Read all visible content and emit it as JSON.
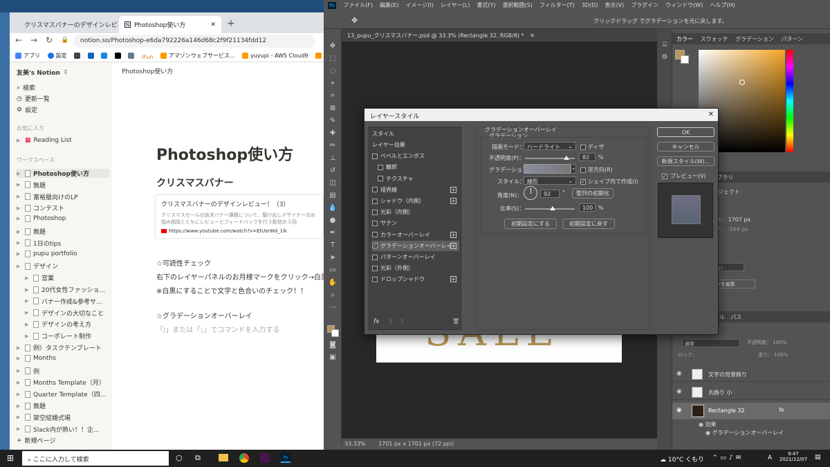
{
  "chrome": {
    "tabs": [
      {
        "title": "クリスマスバナーのデザインレビュー！"
      },
      {
        "title": "Photoshop使い方"
      }
    ],
    "url": "notion.so/Photoshop-e6da792226a146d68c2f9f21134fdd12",
    "bookmarks": [
      "アプリ",
      "設定",
      "",
      "",
      "",
      "",
      "",
      "iFun",
      "アマゾンウェブサービス...",
      "yuyupi - AWS Cloud9",
      "homew"
    ]
  },
  "notion": {
    "workspace": "友美's Notion",
    "top_items": [
      "検索",
      "更新一覧",
      "設定"
    ],
    "favorites_label": "お気に入り",
    "favorites": [
      "Reading List"
    ],
    "workspace_label": "ワークスペース",
    "pages": [
      "Photoshop使い方",
      "無題",
      "富裕層向けのLP",
      "コンテスト",
      "Photoshop",
      "無題",
      "1日のtips",
      "pupu portfolio",
      "デザイン",
      "営業",
      "20代女性ファッショ...",
      "バナー作成&参考サ...",
      "デザインの大切なこと",
      "デザインの考え方",
      "コーポレート制作",
      "例）タスクテンプレート",
      "Months",
      "例",
      "Months Template（月）",
      "Quarter Template（四...",
      "無題",
      "架空結婚式場",
      "Slack内が熱い！！企..."
    ],
    "new_page": "新規ページ",
    "breadcrumb": "Photoshop使い方",
    "title": "Photoshop使い方",
    "h2": "クリスマスバナー",
    "bookmark_title": "クリスマスバナーのデザインレビュー！（3）",
    "bookmark_desc": "クリスマスセールの訴求バナー課題について、駆け出しデザイナーのお悩み相談とともにレビューとフィードバックを行う配信の３回",
    "bookmark_url": "https://www.youtube.com/watch?v=EtUsrWd_1lk",
    "text1": "☆可読性チェック",
    "text2": "右下のレイヤーパネルのお月様マークをクリック→白黒",
    "text3": "※白黒にすることで文字と色合いのチェック！！",
    "text4": "☆グラデーションオーバーレイ",
    "placeholder": "「/」または「；」でコマンドを入力する"
  },
  "photoshop": {
    "menu": [
      "ファイル(F)",
      "編集(E)",
      "イメージ(I)",
      "レイヤー(L)",
      "書式(Y)",
      "選択範囲(S)",
      "フィルター(T)",
      "3D(D)",
      "表示(V)",
      "プラグイン",
      "ウィンドウ(W)",
      "ヘルプ(H)"
    ],
    "options_hint": "クリックドラッグ でグラデーションを元に戻します。",
    "doc_tab": "13_pupu_クリスマスバナー.psd @ 33.3% (Rectangle 32, RGB/8) *",
    "canvas_text": "SALE",
    "zoom": "33.33%",
    "docsize": "1701 px x 1701 px (72 ppi)",
    "color_tabs": [
      "カラー",
      "スウォッチ",
      "グラデーション",
      "パターン"
    ],
    "props": {
      "h": "H：",
      "h_val": "1707 px",
      "y": "Y：",
      "y_val": "-344 px",
      "smart": "スマートオブジェクト",
      "cc": "CC ライブラリ",
      "adj": "調整",
      "apply": "適用しない",
      "edit": "コンテンツを編集"
    },
    "layers_tabs": [
      "チャンネル",
      "パス"
    ],
    "layer_mode": "通常",
    "opacity_label": "不透明度：",
    "opacity_val": "100%",
    "lock_label": "ロック：",
    "fill_label": "塗り：",
    "fill_val": "100%",
    "layers": [
      "文字の背景飾り",
      "丸飾り 小",
      "Rectangle 32"
    ],
    "effects_label": "効果",
    "effect_item": "グラデーションオーバーレイ",
    "colors": {
      "fg": "#b8965a",
      "bg": "#ffffff",
      "gold": "#b89a55"
    }
  },
  "dialog": {
    "title": "レイヤースタイル",
    "styles_header": "スタイル",
    "styles": [
      {
        "label": "レイヤー効果",
        "checkbox": false,
        "plus": false,
        "checked": false
      },
      {
        "label": "ベベルとエンボス",
        "checkbox": true,
        "plus": false,
        "checked": false
      },
      {
        "label": "輪郭",
        "checkbox": true,
        "plus": false,
        "checked": false,
        "indent": true
      },
      {
        "label": "テクスチャ",
        "checkbox": true,
        "plus": false,
        "checked": false,
        "indent": true
      },
      {
        "label": "境界線",
        "checkbox": true,
        "plus": true,
        "checked": false
      },
      {
        "label": "シャドウ（内側）",
        "checkbox": true,
        "plus": true,
        "checked": false
      },
      {
        "label": "光彩（内側）",
        "checkbox": true,
        "plus": false,
        "checked": false
      },
      {
        "label": "サテン",
        "checkbox": true,
        "plus": false,
        "checked": false
      },
      {
        "label": "カラーオーバーレイ",
        "checkbox": true,
        "plus": true,
        "checked": false
      },
      {
        "label": "グラデーションオーバーレイ",
        "checkbox": true,
        "plus": true,
        "checked": true
      },
      {
        "label": "パターンオーバーレイ",
        "checkbox": true,
        "plus": false,
        "checked": false
      },
      {
        "label": "光彩（外側）",
        "checkbox": true,
        "plus": false,
        "checked": false
      },
      {
        "label": "ドロップシャドウ",
        "checkbox": true,
        "plus": true,
        "checked": false
      }
    ],
    "section_title": "グラデーションオーバーレイ",
    "sub_title": "グラデーション",
    "blend_label": "描画モード：",
    "blend_val": "ハードライト",
    "dither": "ディザ",
    "opacity_label": "不透明度(P)：",
    "opacity_val": "82",
    "pct": "%",
    "grad_label": "グラデーション：",
    "reverse": "逆方向(R)",
    "style_label": "スタイル：",
    "style_val": "線形",
    "align": "シェイプ内で作成(I)",
    "angle_label": "角度(N)：",
    "angle_val": "92",
    "deg": "°",
    "reset_align": "整列の初期化",
    "scale_label": "比率(S)：",
    "scale_val": "100",
    "make_default": "初期設定にする",
    "reset_default": "初期設定に戻す",
    "ok": "OK",
    "cancel": "キャンセル",
    "new_style": "新規スタイル(W)...",
    "preview": "プレビュー(V)",
    "fx": "fx"
  },
  "taskbar": {
    "search": "ここに入力して検索",
    "weather": "10°C くもり",
    "time": "9:47",
    "date": "2021/12/07",
    "ime": "A"
  }
}
